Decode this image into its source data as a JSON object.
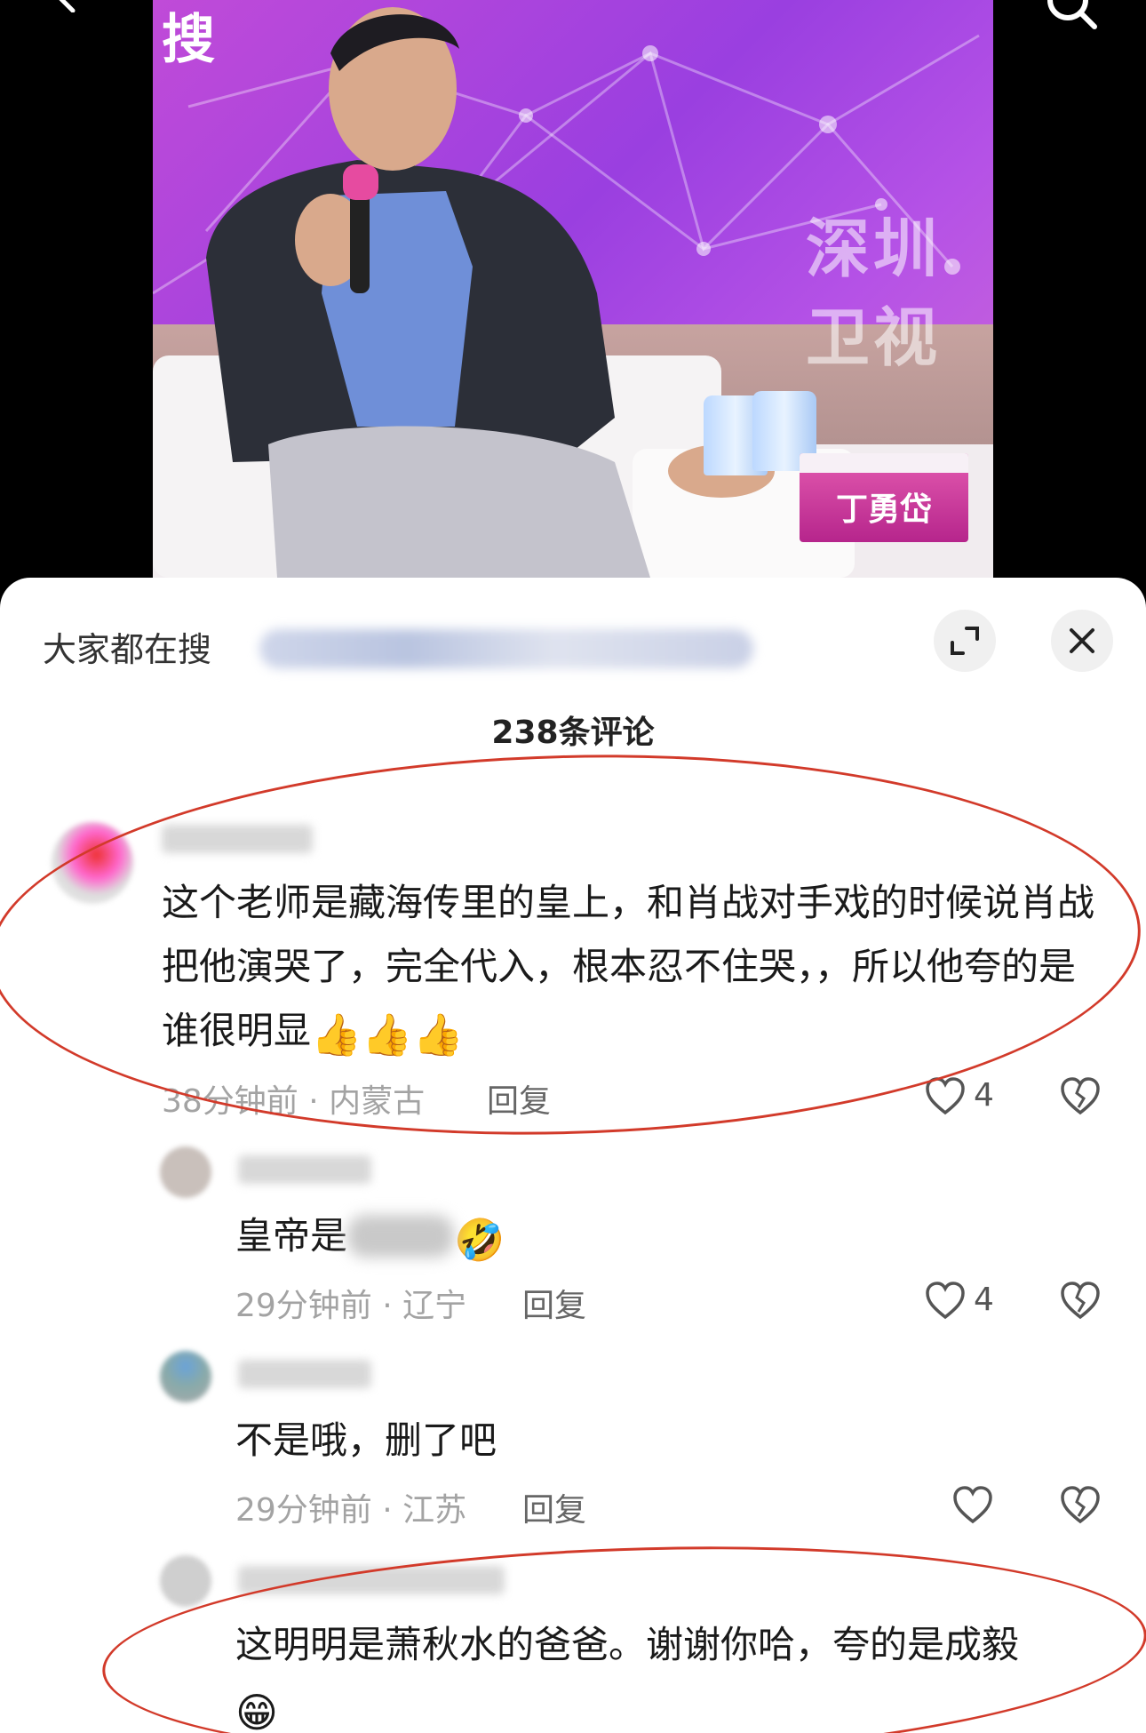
{
  "video": {
    "watermark_text": "深圳卫视",
    "nameplate_text": "丁勇岱",
    "corner_logo_text": "搜"
  },
  "sheet": {
    "search_label": "大家都在搜",
    "comment_count": "238条评论",
    "expand_icon": "expand-icon",
    "close_icon": "close-icon"
  },
  "comments": [
    {
      "text": "这个老师是藏海传里的皇上，和肖战对手戏的时候说肖战把他演哭了，完全代入，根本忍不住哭，，所以他夸的是谁很明显",
      "emoji": "👍👍👍",
      "meta": "38分钟前 · 内蒙古",
      "reply_label": "回复",
      "likes": "4"
    }
  ],
  "replies": [
    {
      "text_before": "皇帝是",
      "text_after": "",
      "emoji": "🤣",
      "meta": "29分钟前 · 辽宁",
      "reply_label": "回复",
      "likes": "4"
    },
    {
      "text": "不是哦，删了吧",
      "meta": "29分钟前 · 江苏",
      "reply_label": "回复",
      "likes": ""
    },
    {
      "text": "这明明是萧秋水的爸爸。谢谢你哈，夸的是成毅",
      "emoji": "😁"
    }
  ],
  "colors": {
    "annotation_ring": "#d23a2a",
    "frame_purple": "#9a3fe0",
    "meta_gray": "#a3a3a3"
  }
}
